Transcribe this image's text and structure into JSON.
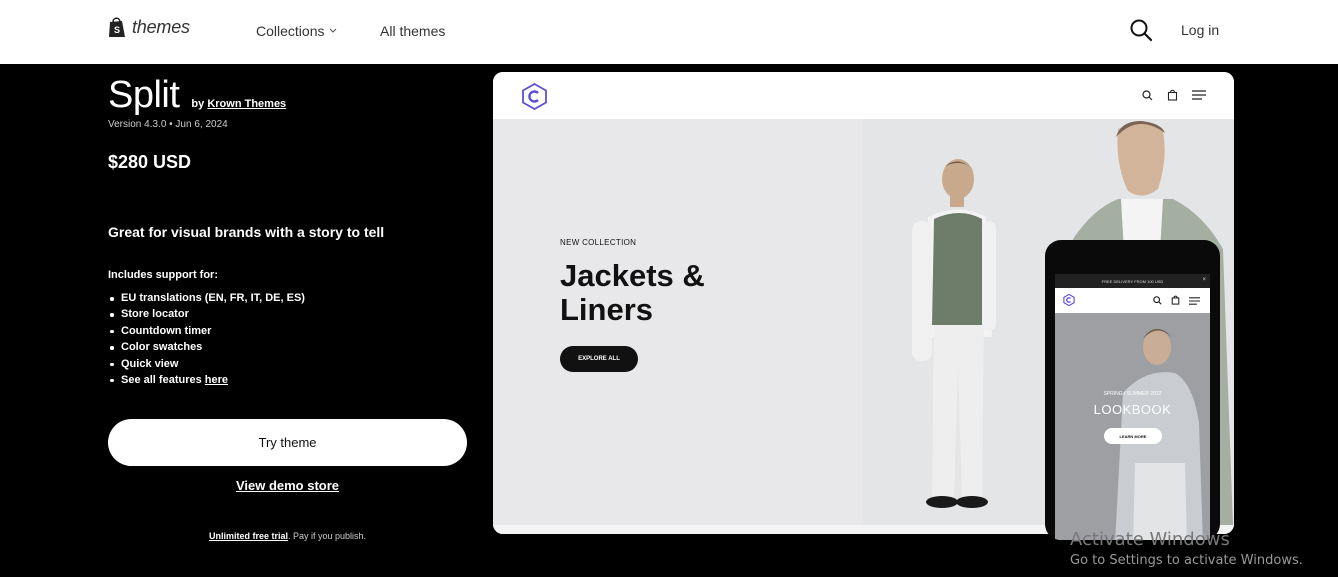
{
  "header": {
    "logo_text": "themes",
    "nav_collections": "Collections",
    "nav_all_themes": "All themes",
    "login": "Log in"
  },
  "theme": {
    "name": "Split",
    "by_prefix": "by",
    "author": "Krown Themes",
    "version": "Version 4.3.0 • Jun 6, 2024",
    "price": "$280 USD",
    "tagline": "Great for visual brands with a story to tell",
    "includes_label": "Includes support for:",
    "features": [
      "EU translations (EN, FR, IT, DE, ES)",
      "Store locator",
      "Countdown timer",
      "Color swatches",
      "Quick view"
    ],
    "features_link_prefix": "See all features",
    "features_link": "here",
    "try_button": "Try theme",
    "demo_link": "View demo store",
    "trial_link": "Unlimited free trial",
    "trial_note": ". Pay if you publish."
  },
  "preview": {
    "kicker": "NEW COLLECTION",
    "headline": "Jackets & Liners",
    "cta": "EXPLORE ALL"
  },
  "mobile": {
    "banner": "FREE DELIVERY FROM 100 USD",
    "close": "×",
    "season": "SPRING / SUMMER 2022",
    "lookbook": "LOOKBOOK",
    "cta": "LEARN MORE"
  },
  "overlay": {
    "line1": "Activate Windows",
    "line2": "Go to Settings to activate Windows."
  }
}
